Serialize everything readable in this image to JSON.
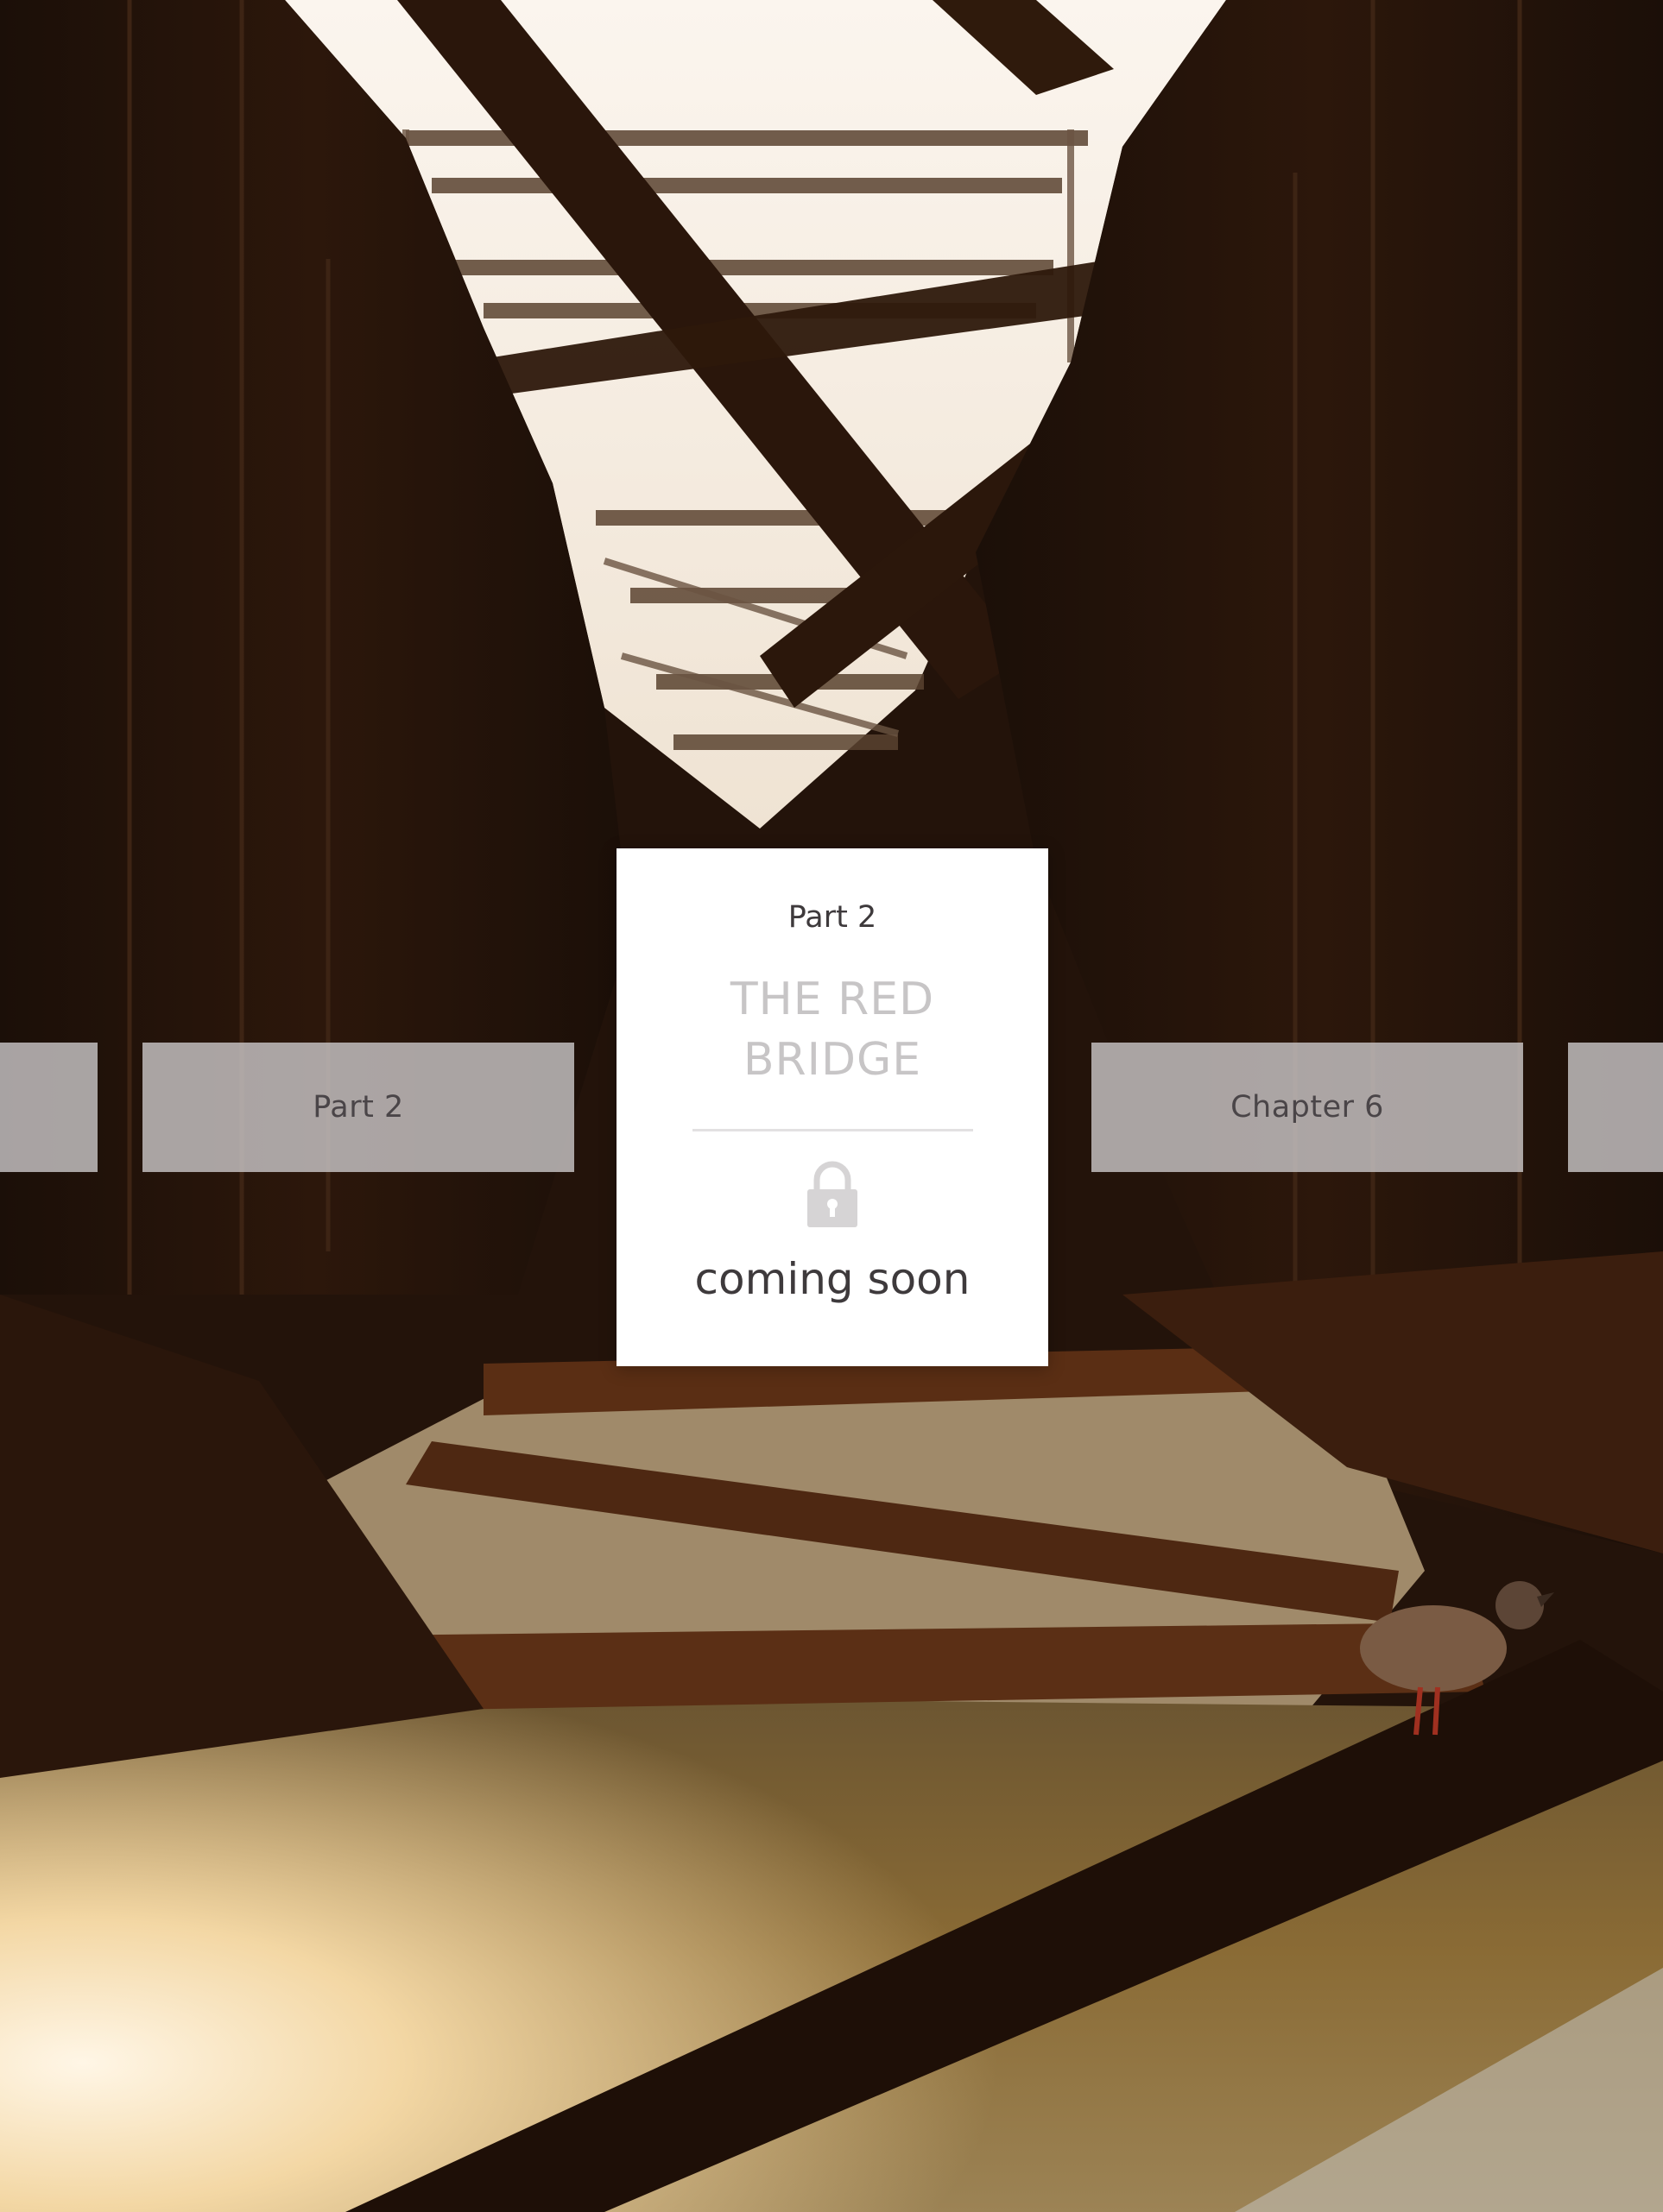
{
  "carousel": {
    "prev_label": "Part 2",
    "next_label": "Chapter 6",
    "current": {
      "part_label": "Part 2",
      "title_line1": "THE RED",
      "title_line2": "BRIDGE",
      "status": "coming soon",
      "status_icon": "lock-icon"
    }
  },
  "colors": {
    "tile_bg": "#c8c4c6",
    "card_bg": "#ffffff",
    "title_text": "#c7c5c6",
    "body_text": "#3e3a3c",
    "lock_icon": "#d6d4d5"
  }
}
